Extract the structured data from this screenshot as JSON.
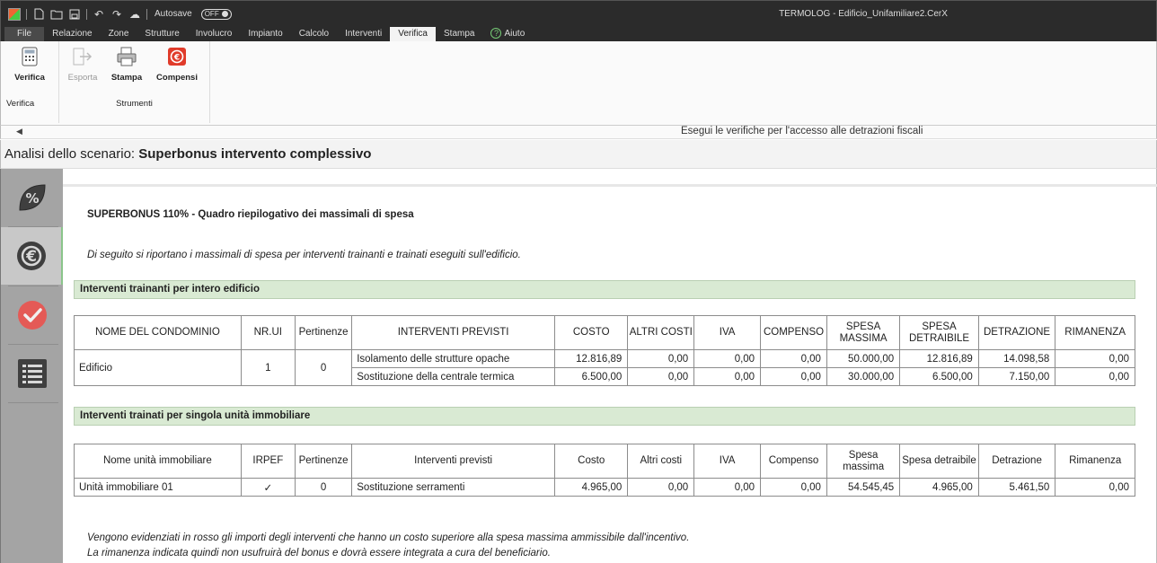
{
  "titlebar": {
    "autosave_label": "Autosave",
    "autosave_state": "OFF",
    "window_title": "TERMOLOG - Edificio_Unifamiliare2.CerX"
  },
  "tabs": [
    "File",
    "Relazione",
    "Zone",
    "Strutture",
    "Involucro",
    "Impianto",
    "Calcolo",
    "Interventi",
    "Verifica",
    "Stampa",
    "Aiuto"
  ],
  "active_tab": "Verifica",
  "ribbon": {
    "buttons": {
      "verifica": "Verifica",
      "esporta": "Esporta",
      "stampa": "Stampa",
      "compensi": "Compensi"
    },
    "groups": {
      "verifica": "Verifica",
      "strumenti": "Strumenti"
    },
    "hint": "Esegui le verifiche per l'accesso alle detrazioni fiscali"
  },
  "scenario": {
    "prefix": "Analisi dello scenario: ",
    "name": "Superbonus intervento complessivo"
  },
  "report": {
    "title": "SUPERBONUS 110% - Quadro riepilogativo dei massimali di spesa",
    "intro": "Di seguito si riportano i massimali di spesa per interventi trainanti e trainati eseguiti sull'edificio.",
    "trainanti": {
      "heading": "Interventi trainanti per intero edificio",
      "headers": [
        "NOME DEL CONDOMINIO",
        "NR.UI",
        "Pertinenze",
        "INTERVENTI PREVISTI",
        "COSTO",
        "ALTRI COSTI",
        "IVA",
        "COMPENSO",
        "SPESA MASSIMA",
        "SPESA DETRAIBILE",
        "DETRAZIONE",
        "RIMANENZA"
      ],
      "building": "Edificio",
      "nr_ui": "1",
      "pertinenze": "0",
      "rows": [
        {
          "intervento": "Isolamento delle strutture opache",
          "costo": "12.816,89",
          "altri": "0,00",
          "iva": "0,00",
          "compenso": "0,00",
          "massima": "50.000,00",
          "detraibile": "12.816,89",
          "detrazione": "14.098,58",
          "rimanenza": "0,00"
        },
        {
          "intervento": "Sostituzione della centrale termica",
          "costo": "6.500,00",
          "altri": "0,00",
          "iva": "0,00",
          "compenso": "0,00",
          "massima": "30.000,00",
          "detraibile": "6.500,00",
          "detrazione": "7.150,00",
          "rimanenza": "0,00"
        }
      ]
    },
    "trainati": {
      "heading": "Interventi trainati per singola unità immobiliare",
      "headers": [
        "Nome unità immobiliare",
        "IRPEF",
        "Pertinenze",
        "Interventi previsti",
        "Costo",
        "Altri costi",
        "IVA",
        "Compenso",
        "Spesa massima",
        "Spesa detraibile",
        "Detrazione",
        "Rimanenza"
      ],
      "rows": [
        {
          "nome": "Unità immobiliare 01",
          "irpef": "✓",
          "pertinenze": "0",
          "intervento": "Sostituzione serramenti",
          "costo": "4.965,00",
          "altri": "0,00",
          "iva": "0,00",
          "compenso": "0,00",
          "massima": "54.545,45",
          "detraibile": "4.965,00",
          "detrazione": "5.461,50",
          "rimanenza": "0,00"
        }
      ]
    },
    "notes": [
      "Vengono evidenziati in rosso gli importi degli interventi che hanno un costo superiore alla spesa massima ammissibile dall'incentivo.",
      "La rimanenza indicata quindi non usufruirà del bonus e dovrà essere integrata a cura del beneficiario."
    ]
  }
}
